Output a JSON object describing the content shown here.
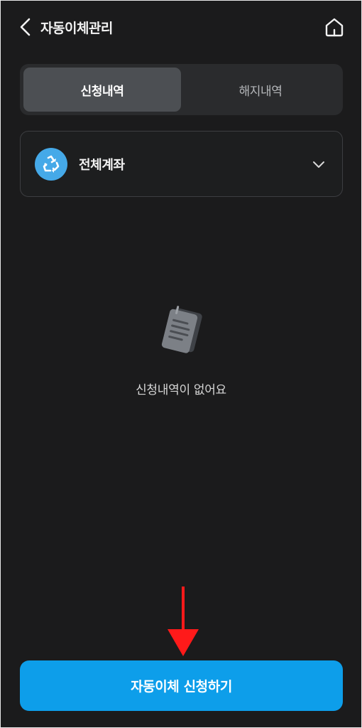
{
  "header": {
    "title": "자동이체관리",
    "back_icon": "chevron-left-icon",
    "home_icon": "home-icon"
  },
  "tabs": [
    {
      "label": "신청내역",
      "active": true
    },
    {
      "label": "해지내역",
      "active": false
    }
  ],
  "account_selector": {
    "label": "전체계좌",
    "icon": "recycle-icon",
    "dropdown_icon": "chevron-down-icon"
  },
  "empty_state": {
    "icon": "document-icon",
    "message": "신청내역이 없어요"
  },
  "primary_action": {
    "label": "자동이체 신청하기"
  },
  "annotation": {
    "icon": "red-arrow-down-icon",
    "color": "#ff1a1a"
  },
  "colors": {
    "background": "#1b1b1c",
    "accent": "#0d9eea",
    "tab_active": "#4c4f53",
    "account_icon": "#45a9e8"
  }
}
